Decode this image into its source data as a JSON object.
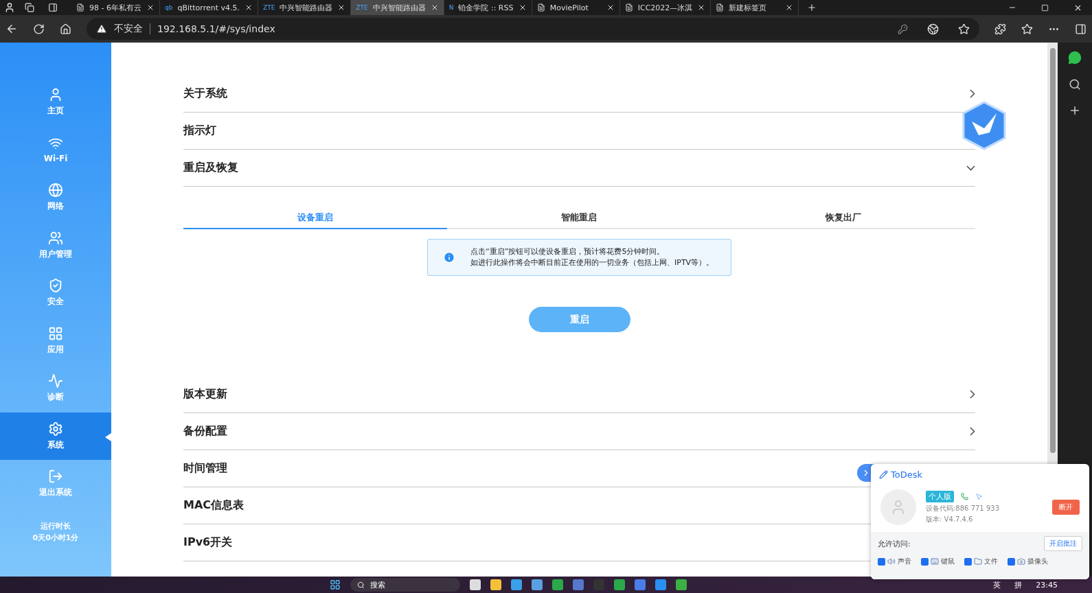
{
  "browser": {
    "tabs": [
      {
        "title": "98 - 6年私有云",
        "selected": false
      },
      {
        "title": "qBittorrent v4.5.",
        "icon_text": "qb",
        "selected": false
      },
      {
        "title": "中兴智能路由器",
        "icon_text": "ZTE",
        "selected": false
      },
      {
        "title": "中兴智能路由器",
        "icon_text": "ZTE",
        "selected": true
      },
      {
        "title": "铂金学院 :: RSS",
        "icon_text": "N",
        "selected": false
      },
      {
        "title": "MoviePilot",
        "selected": false
      },
      {
        "title": "ICC2022—冰淇",
        "selected": false
      },
      {
        "title": "新建标签页",
        "selected": false
      }
    ],
    "security": "不安全",
    "url": "192.168.5.1/#/sys/index"
  },
  "sidebar": {
    "items": [
      {
        "label": "主页",
        "selected": false
      },
      {
        "label": "Wi-Fi",
        "selected": false
      },
      {
        "label": "网络",
        "selected": false
      },
      {
        "label": "用户管理",
        "selected": false
      },
      {
        "label": "安全",
        "selected": false
      },
      {
        "label": "应用",
        "selected": false
      },
      {
        "label": "诊断",
        "selected": false
      },
      {
        "label": "系统",
        "selected": true
      }
    ],
    "logout": "退出系统",
    "uptime_label": "运行时长",
    "uptime": "0天0小时1分"
  },
  "sections": [
    {
      "title": "关于系统",
      "expanded": false
    },
    {
      "title": "指示灯"
    },
    {
      "title": "重启及恢复",
      "expanded": true
    },
    {
      "title": "版本更新",
      "expanded": false
    },
    {
      "title": "备份配置",
      "expanded": false
    },
    {
      "title": "时间管理"
    },
    {
      "title": "MAC信息表"
    },
    {
      "title": "IPv6开关"
    }
  ],
  "restore": {
    "tabs": [
      {
        "label": "设备重启",
        "selected": true
      },
      {
        "label": "智能重启",
        "selected": false
      },
      {
        "label": "恢复出厂",
        "selected": false
      }
    ],
    "notice": [
      "点击“重启”按钮可以使设备重启，预计将花费5分钟时间。",
      "如进行此操作将会中断目前正在使用的一切业务（包括上网、IPTV等）。"
    ],
    "button": "重启"
  },
  "todesk": {
    "title": "ToDesk",
    "badge": "个人版",
    "device_code": "设备代码:886 771 933",
    "version": "版本: V4.7.4.6",
    "disconnect": "断开",
    "allow_label": "允许访问:",
    "annotate": "开启批注",
    "permissions": [
      {
        "label": "声音",
        "checked": true
      },
      {
        "label": "键鼠",
        "checked": true
      },
      {
        "label": "文件",
        "checked": true
      },
      {
        "label": "摄像头",
        "checked": true
      }
    ]
  },
  "taskbar": {
    "search": "搜索",
    "ime": [
      "英",
      "拼"
    ],
    "time": "23:45"
  }
}
